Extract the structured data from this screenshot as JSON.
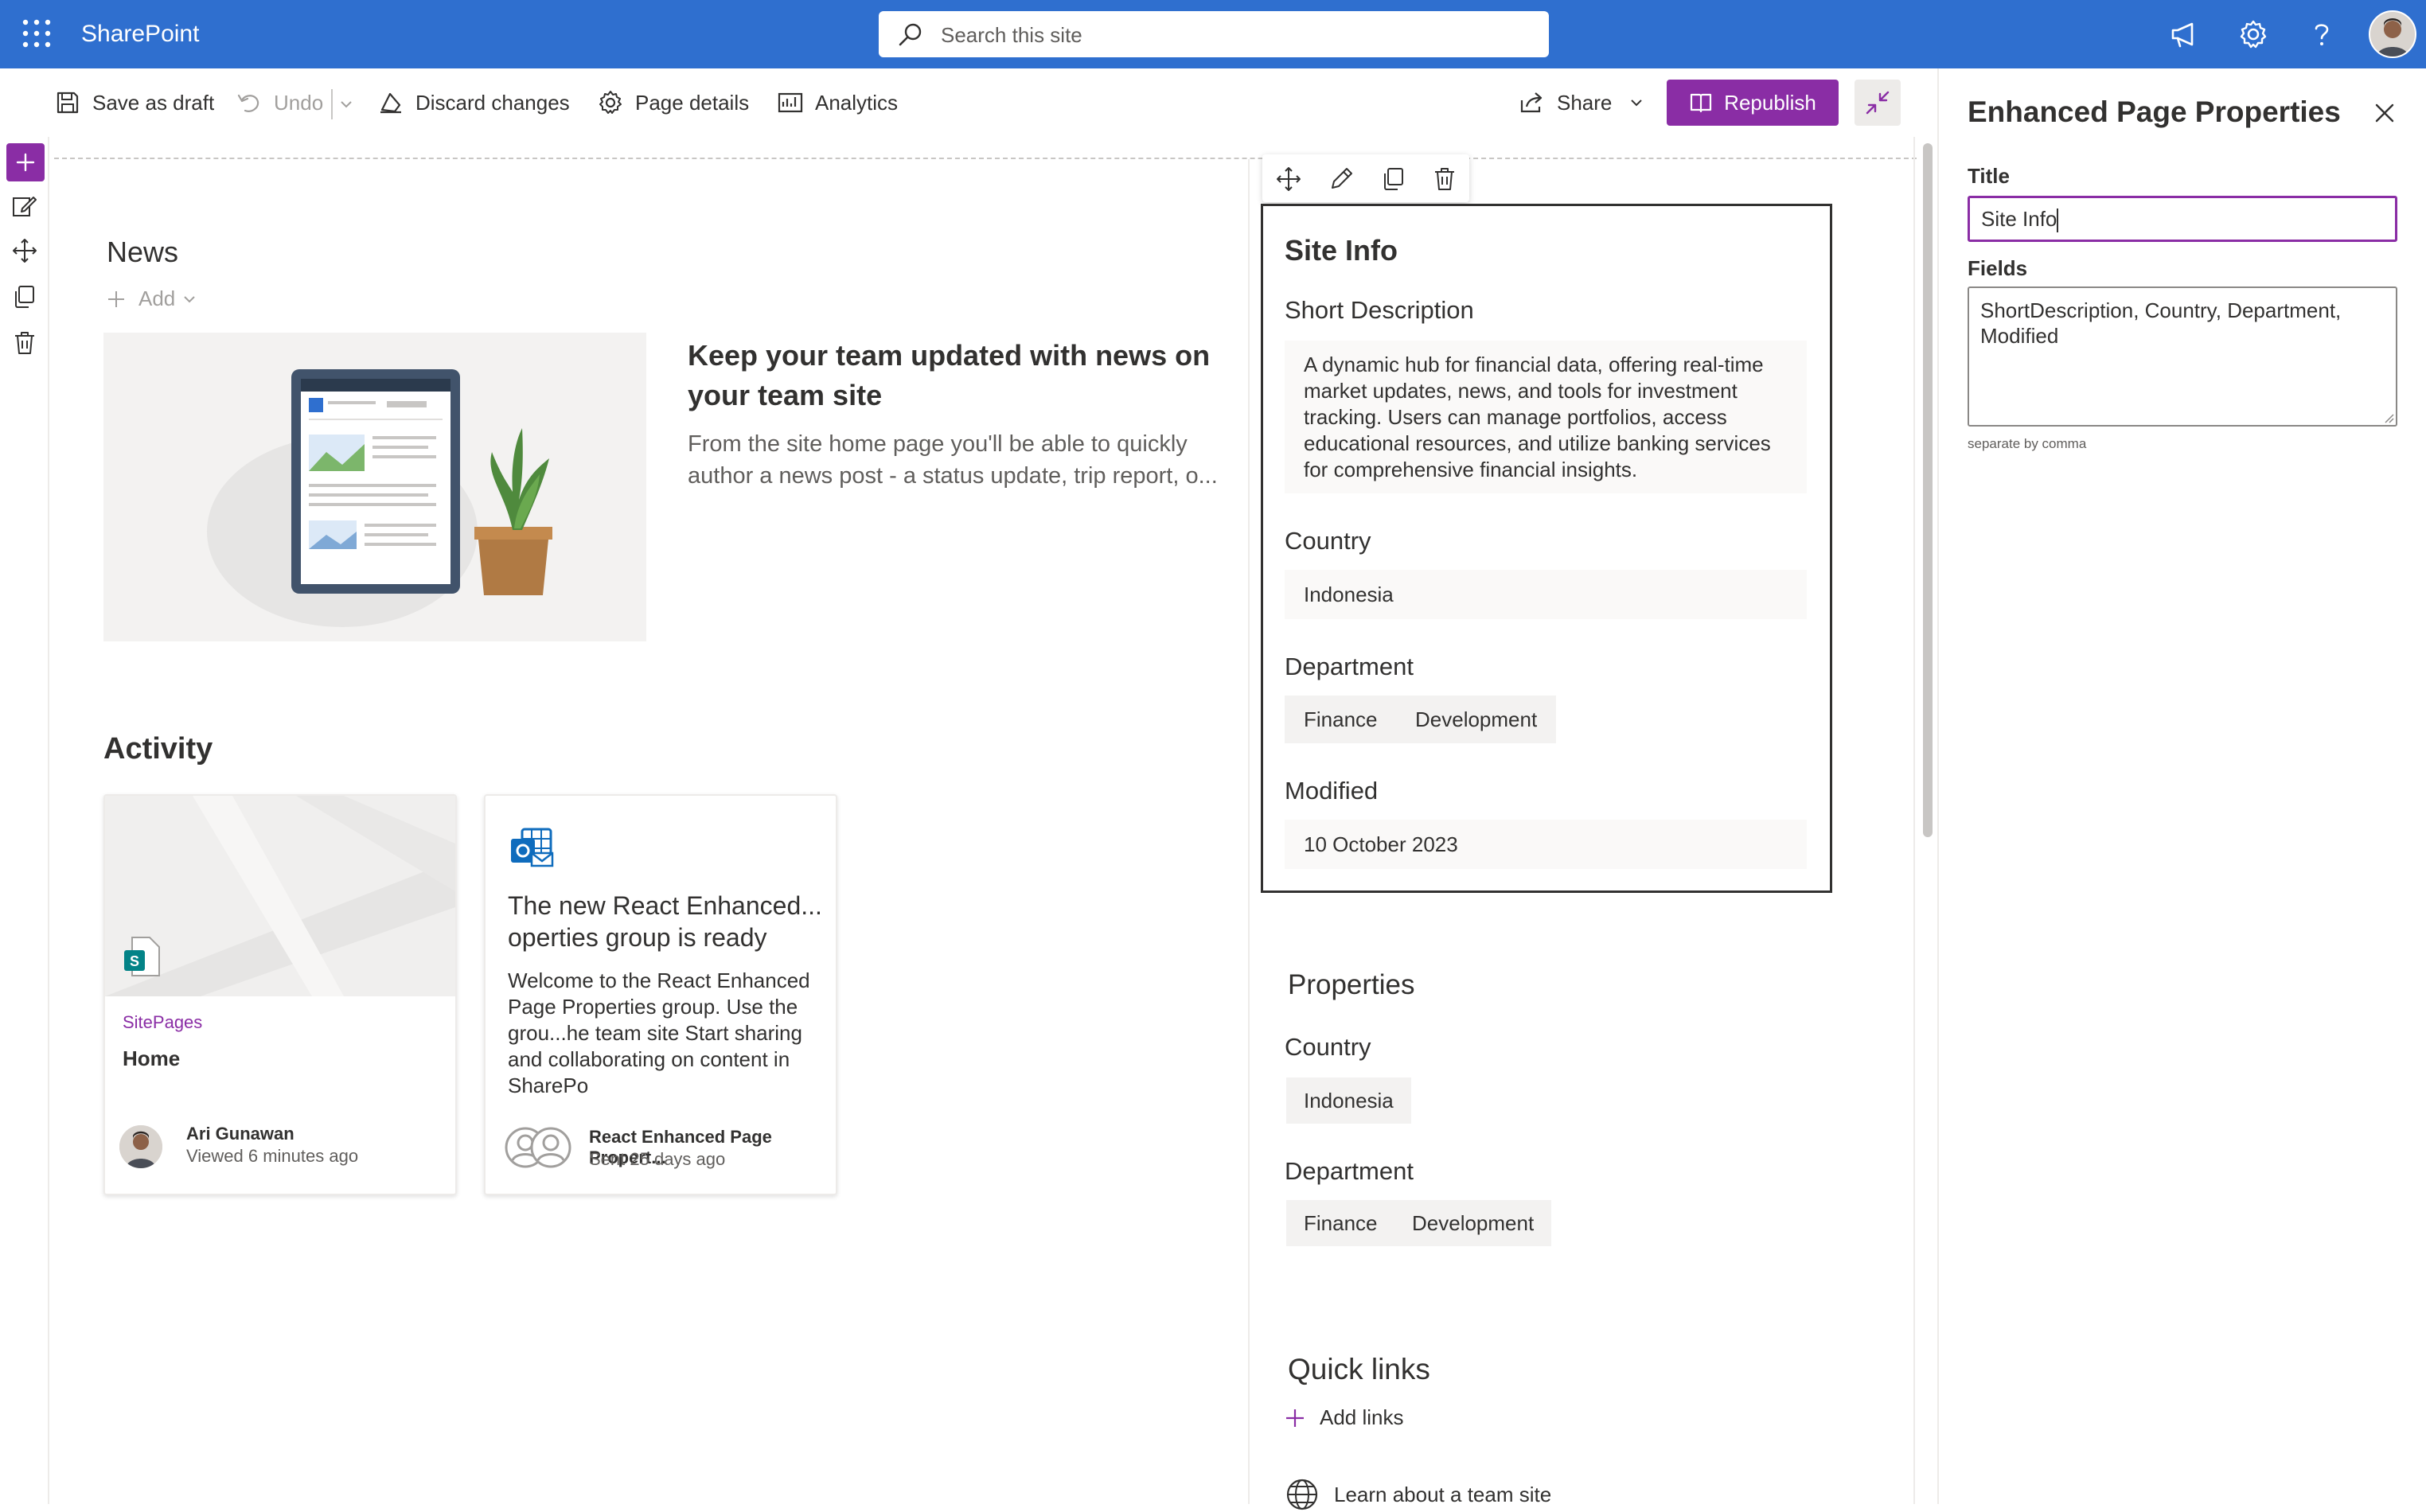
{
  "suite_bar": {
    "app_name": "SharePoint",
    "search_placeholder": "Search this site",
    "accent": "#2f6fcf"
  },
  "command_bar": {
    "save_draft": "Save as draft",
    "undo": "Undo",
    "discard": "Discard changes",
    "page_details": "Page details",
    "analytics": "Analytics",
    "share": "Share",
    "republish": "Republish",
    "republish_color": "#8a2da5"
  },
  "news": {
    "heading": "News",
    "add_label": "Add",
    "headline": "Keep your team updated with news on your team site",
    "description": "From the site home page you'll be able to quickly author a news post - a status update, trip report, o..."
  },
  "activity": {
    "heading": "Activity",
    "cards": [
      {
        "label": "SitePages",
        "title": "Home",
        "person": "Ari Gunawan",
        "meta": "Viewed 6 minutes ago"
      },
      {
        "title": "The new React Enhanced... operties group is ready",
        "body": "Welcome to the React Enhanced Page Properties group. Use the grou...he team site Start sharing and collaborating on content in SharePo",
        "person": "React Enhanced Page Propert...",
        "meta": "Sent 25 days ago"
      }
    ]
  },
  "site_info": {
    "title": "Site Info",
    "short_description_label": "Short Description",
    "short_description": "A dynamic hub for financial data, offering real-time market updates, news, and tools for investment tracking. Users can manage portfolios, access educational resources, and utilize banking services for comprehensive financial insights.",
    "country_label": "Country",
    "country": "Indonesia",
    "department_label": "Department",
    "departments": [
      "Finance",
      "Development"
    ],
    "modified_label": "Modified",
    "modified": "10 October 2023"
  },
  "properties": {
    "heading": "Properties",
    "country_label": "Country",
    "country": "Indonesia",
    "department_label": "Department",
    "departments": [
      "Finance",
      "Development"
    ]
  },
  "quick_links": {
    "heading": "Quick links",
    "add_label": "Add links",
    "link": "Learn about a team site"
  },
  "panel": {
    "title": "Enhanced Page Properties",
    "title_label": "Title",
    "title_value": "Site Info",
    "fields_label": "Fields",
    "fields_value": "ShortDescription, Country, Department, Modified",
    "fields_hint": "separate by comma"
  }
}
